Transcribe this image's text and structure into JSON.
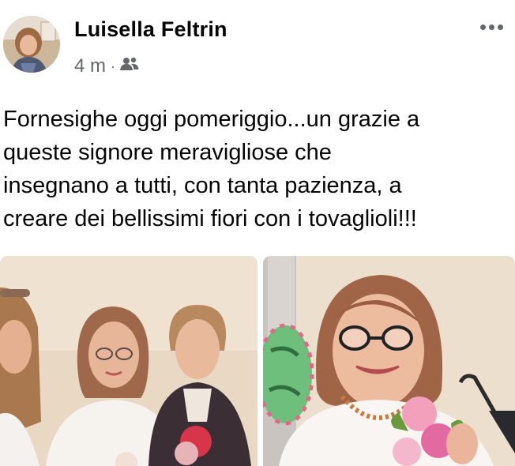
{
  "post": {
    "author": "Luisella Feltrin",
    "time": "4 m",
    "separator": "·",
    "audience_icon": "friends-icon",
    "more_icon": "more-options-icon",
    "text_lines": [
      "Fornesighe oggi pomeriggio...un grazie a",
      "queste signore meravigliose che",
      "insegnano a tutti, con tanta pazienza, a",
      "creare dei bellissimi fiori con i tovaglioli!!!"
    ]
  }
}
